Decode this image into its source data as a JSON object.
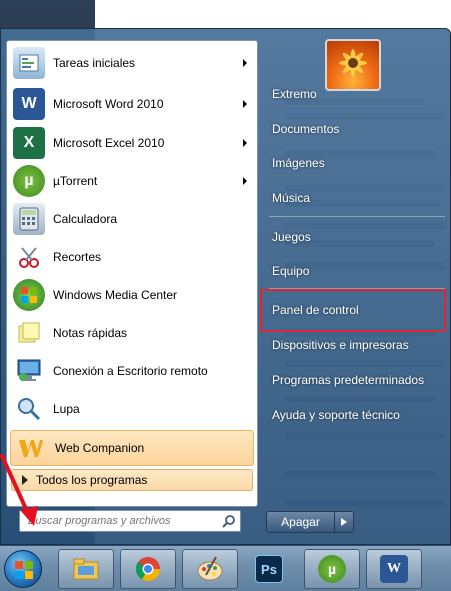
{
  "start_menu": {
    "programs": [
      {
        "label": "Tareas iniciales",
        "icon": "getting-started-icon",
        "has_submenu": true
      },
      {
        "label": "Microsoft Word 2010",
        "icon": "word-icon",
        "has_submenu": true
      },
      {
        "label": "Microsoft Excel 2010",
        "icon": "excel-icon",
        "has_submenu": true
      },
      {
        "label": "µTorrent",
        "icon": "utorrent-icon",
        "has_submenu": true
      },
      {
        "label": "Calculadora",
        "icon": "calculator-icon",
        "has_submenu": false
      },
      {
        "label": "Recortes",
        "icon": "snipping-tool-icon",
        "has_submenu": false
      },
      {
        "label": "Windows Media Center",
        "icon": "media-center-icon",
        "has_submenu": false
      },
      {
        "label": "Notas rápidas",
        "icon": "sticky-notes-icon",
        "has_submenu": false
      },
      {
        "label": "Conexión a Escritorio remoto",
        "icon": "remote-desktop-icon",
        "has_submenu": false
      },
      {
        "label": "Lupa",
        "icon": "magnifier-icon",
        "has_submenu": false
      },
      {
        "label": "Web Companion",
        "icon": "web-companion-icon",
        "has_submenu": false,
        "highlighted": true
      }
    ],
    "all_programs_label": "Todos los programas",
    "search": {
      "placeholder": "Buscar programas y archivos"
    },
    "right_items": [
      "Extremo",
      "Documentos",
      "Imágenes",
      "Música",
      "Juegos",
      "Equipo",
      "Panel de control",
      "Dispositivos e impresoras",
      "Programas predeterminados",
      "Ayuda y soporte técnico"
    ],
    "highlighted_right_item": "Panel de control",
    "shutdown_label": "Apagar"
  },
  "taskbar": {
    "pinned": [
      "file-explorer-icon",
      "chrome-icon",
      "paint-icon",
      "photoshop-icon",
      "utorrent-icon",
      "word-icon"
    ],
    "photoshop_label": "Ps",
    "word_label": "W"
  },
  "colors": {
    "highlight_border": "#e02633",
    "annotation_arrow": "#e3101d",
    "word": "#2b5797",
    "excel": "#1e7145",
    "utorrent": "#5fa72b"
  }
}
